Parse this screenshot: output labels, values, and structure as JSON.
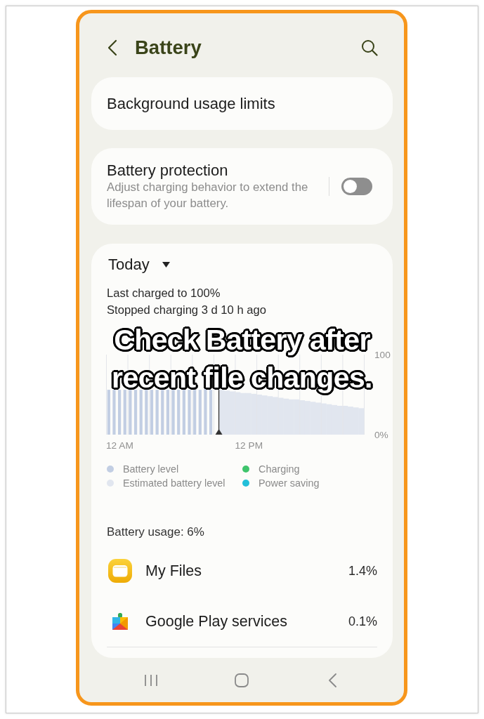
{
  "header": {
    "title": "Battery"
  },
  "settings": [
    {
      "kind": "link",
      "title": "Background usage limits"
    },
    {
      "kind": "toggle",
      "title": "Battery protection",
      "subtitle": "Adjust charging behavior to extend the lifespan of your battery.",
      "on": false
    }
  ],
  "usage_card": {
    "period": "Today",
    "status_lines": [
      "Last charged to 100%",
      "Stopped charging 3 d 10 h ago"
    ],
    "chart_data": {
      "type": "bar",
      "categories": [
        null,
        null,
        "12 AM",
        null,
        null,
        null,
        null,
        null,
        null,
        null,
        null,
        null,
        null,
        null,
        null,
        null,
        null,
        null,
        null,
        null,
        null,
        null,
        null,
        null,
        null,
        null,
        "12 PM",
        null,
        null,
        null,
        null,
        null,
        null,
        null,
        null,
        null,
        null,
        null,
        null,
        null,
        null,
        null,
        null,
        null,
        null,
        null,
        null,
        null
      ],
      "ylim": [
        0,
        100
      ],
      "yticks": [
        {
          "value": 0,
          "label": "0%"
        },
        {
          "value": 100,
          "label": "100"
        }
      ],
      "series": [
        {
          "name": "Battery level",
          "color": "#c2cee3",
          "values": [
            56,
            56,
            56,
            56,
            56,
            56,
            56,
            56,
            56,
            56,
            56,
            56,
            56,
            56,
            56,
            56,
            56,
            56,
            57,
            56,
            null,
            null,
            null,
            null,
            null,
            null,
            null,
            null,
            null,
            null,
            null,
            null,
            null,
            null,
            null,
            null,
            null,
            null,
            null,
            null,
            null,
            null,
            null,
            null,
            null,
            null,
            null,
            null
          ]
        },
        {
          "name": "Estimated battery level",
          "color": "#e1e6ef",
          "values": [
            null,
            null,
            null,
            null,
            null,
            null,
            null,
            null,
            null,
            null,
            null,
            null,
            null,
            null,
            null,
            null,
            null,
            null,
            null,
            null,
            null,
            56,
            55,
            54,
            53,
            52,
            52,
            51,
            50,
            49,
            48,
            47,
            46,
            45,
            44,
            44,
            43,
            42,
            41,
            40,
            39,
            38,
            37,
            36,
            36,
            35,
            34,
            33
          ]
        }
      ]
    },
    "legend_extra": [
      {
        "label": "Charging",
        "color": "#3fc46c"
      },
      {
        "label": "Power saving",
        "color": "#22bfd9"
      }
    ],
    "usage_total": "Battery usage: 6%",
    "apps": [
      {
        "kind": "files",
        "name": "My Files",
        "usage": "1.4%"
      },
      {
        "kind": "play-services",
        "name": "Google Play services",
        "usage": "0.1%"
      }
    ]
  },
  "caption": "Check Battery after recent file changes."
}
